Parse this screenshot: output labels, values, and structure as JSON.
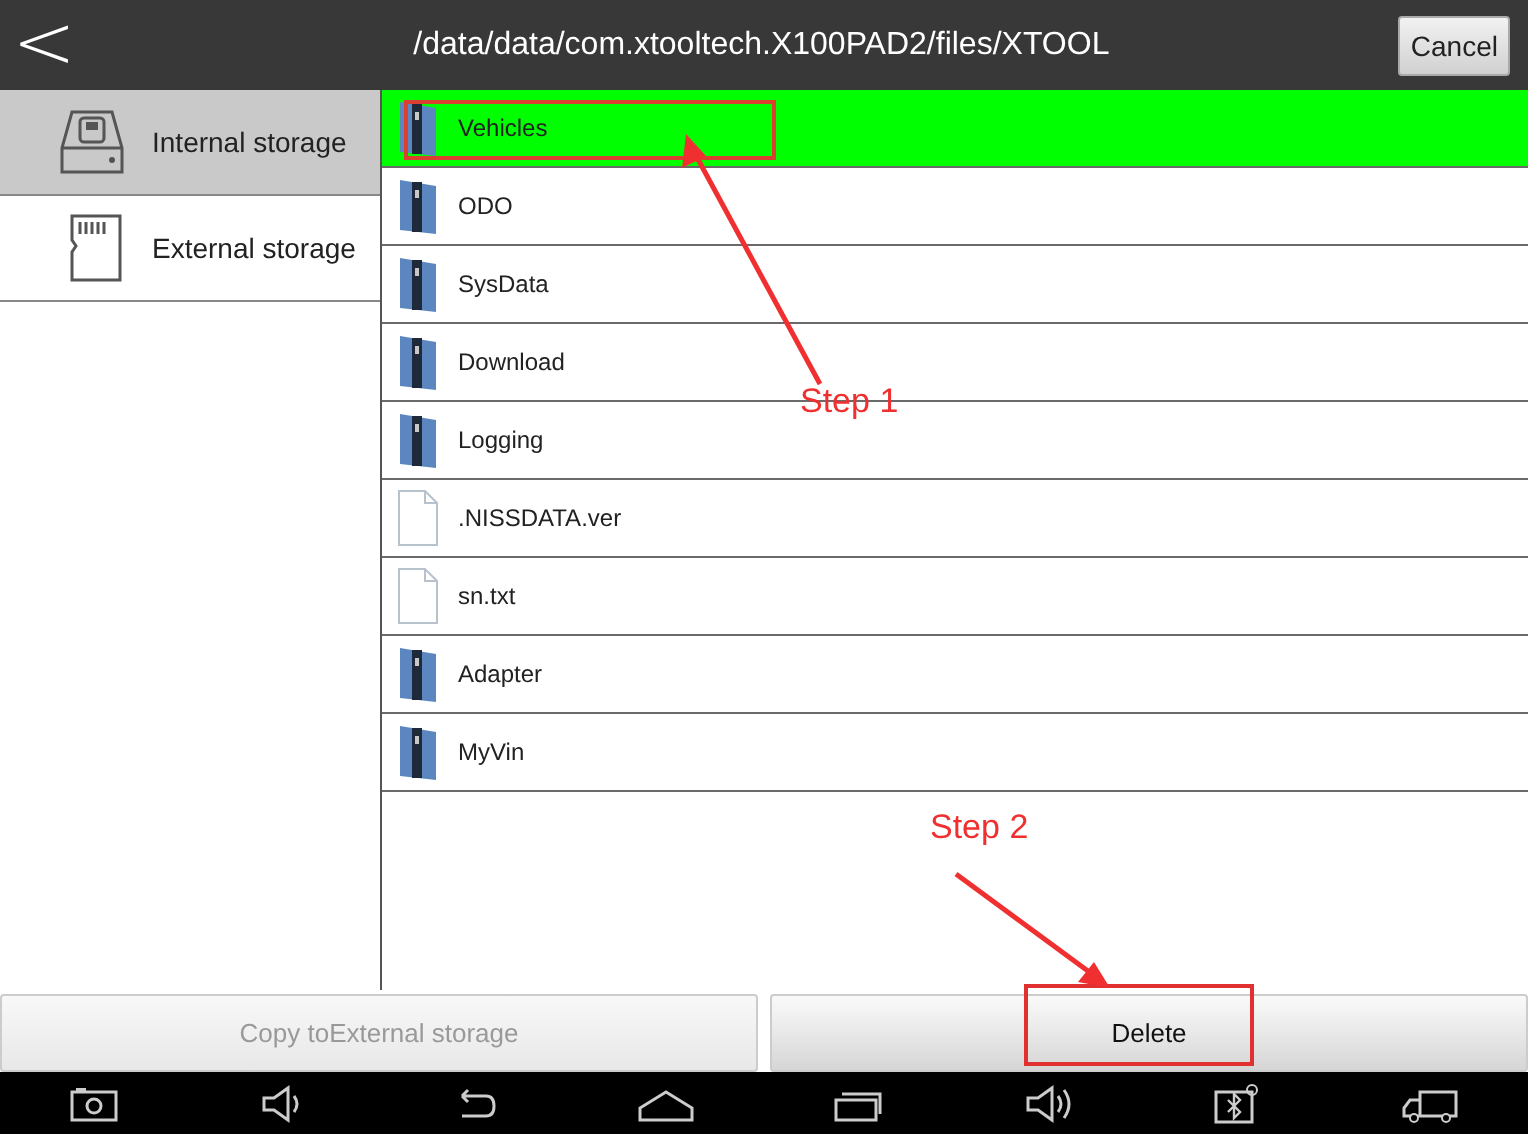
{
  "header": {
    "back": "<",
    "path": "/data/data/com.xtooltech.X100PAD2/files/XTOOL",
    "cancel": "Cancel"
  },
  "sidebar": {
    "items": [
      {
        "label": "Internal storage",
        "kind": "drive",
        "selected": true
      },
      {
        "label": "External storage",
        "kind": "sdcard",
        "selected": false
      }
    ]
  },
  "files": [
    {
      "name": "Vehicles",
      "kind": "folder",
      "selected": true
    },
    {
      "name": "ODO",
      "kind": "folder",
      "selected": false
    },
    {
      "name": "SysData",
      "kind": "folder",
      "selected": false
    },
    {
      "name": "Download",
      "kind": "folder",
      "selected": false
    },
    {
      "name": "Logging",
      "kind": "folder",
      "selected": false
    },
    {
      "name": ".NISSDATA.ver",
      "kind": "file",
      "selected": false
    },
    {
      "name": "sn.txt",
      "kind": "file",
      "selected": false
    },
    {
      "name": "Adapter",
      "kind": "folder",
      "selected": false
    },
    {
      "name": "MyVin",
      "kind": "folder",
      "selected": false
    }
  ],
  "actions": [
    {
      "label": "Copy toExternal storage",
      "disabled": true
    },
    {
      "label": "Delete",
      "disabled": false
    }
  ],
  "annotations": [
    {
      "label": "Step 1"
    },
    {
      "label": "Step 2"
    }
  ]
}
